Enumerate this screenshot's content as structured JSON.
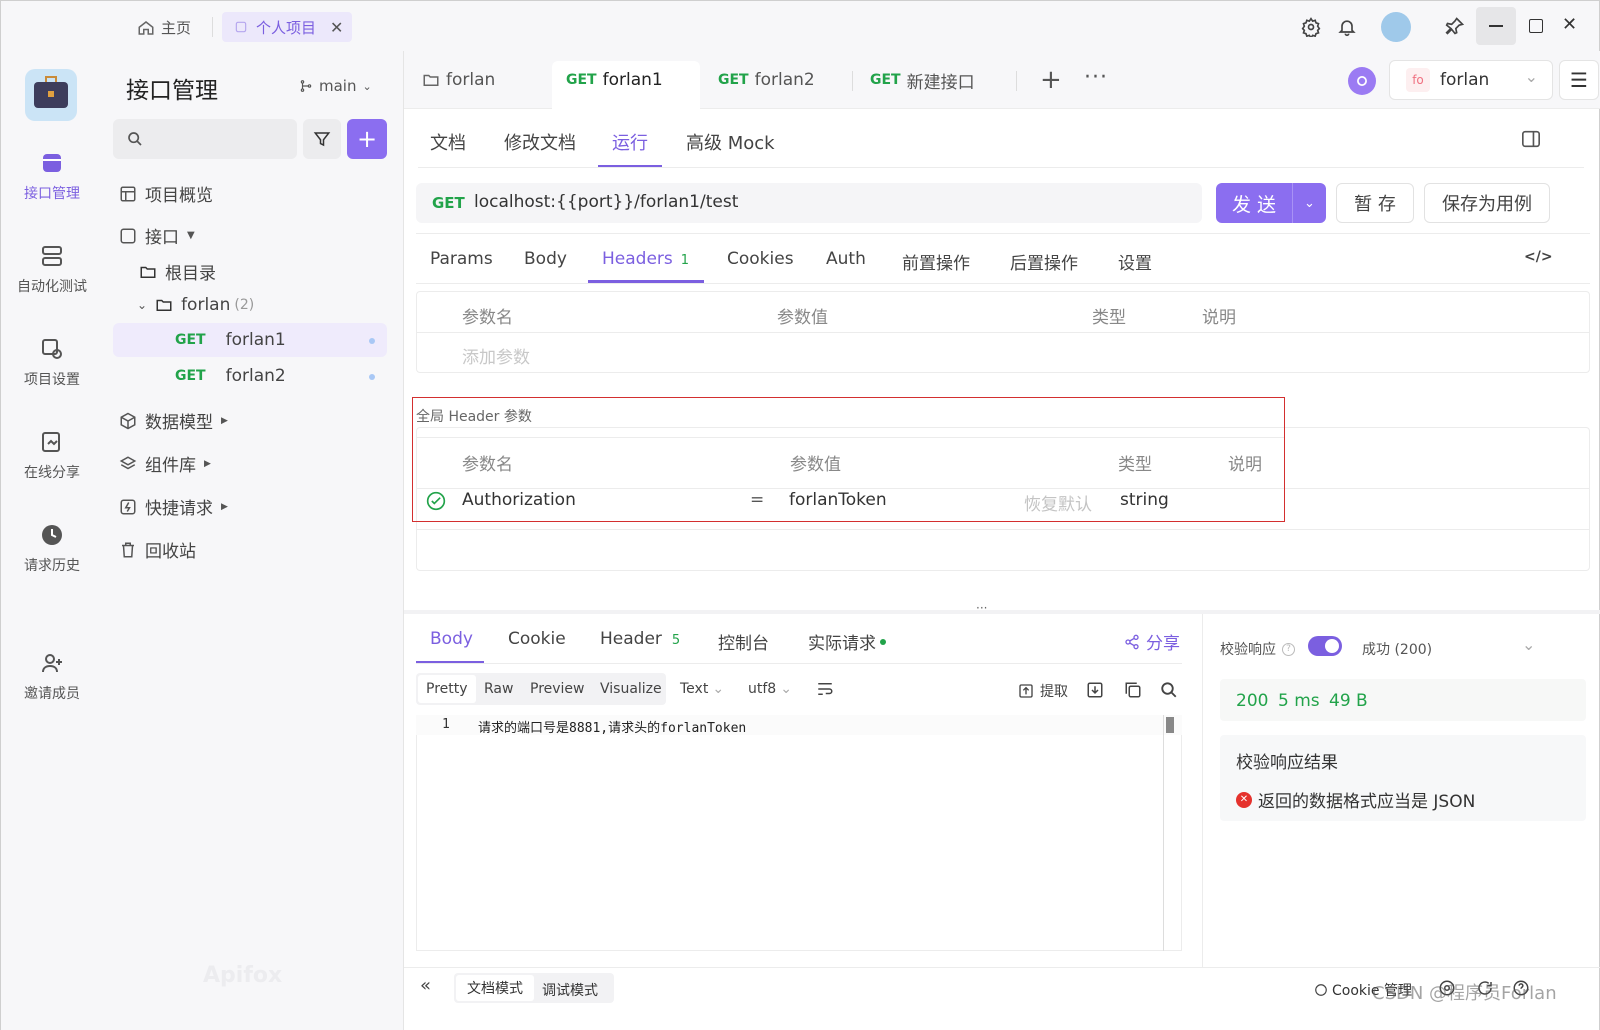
{
  "titlebar": {
    "home_label": "主页",
    "project_tab_label": "个人项目"
  },
  "rail": {
    "items": [
      {
        "label": "接口管理"
      },
      {
        "label": "自动化测试"
      },
      {
        "label": "项目设置"
      },
      {
        "label": "在线分享"
      },
      {
        "label": "请求历史"
      },
      {
        "label": "邀请成员"
      }
    ]
  },
  "sidebar": {
    "title": "接口管理",
    "branch": "main",
    "nav": [
      {
        "label": "项目概览"
      },
      {
        "label": "接口"
      },
      {
        "label": "根目录"
      },
      {
        "label": "forlan",
        "count": "(2)"
      },
      {
        "method": "GET",
        "label": "forlan1"
      },
      {
        "method": "GET",
        "label": "forlan2"
      },
      {
        "label": "数据模型"
      },
      {
        "label": "组件库"
      },
      {
        "label": "快捷请求"
      },
      {
        "label": "回收站"
      }
    ],
    "watermark": "Apifox"
  },
  "tabs": {
    "items": [
      {
        "method": "",
        "label": "forlan"
      },
      {
        "method": "GET",
        "label": "forlan1"
      },
      {
        "method": "GET",
        "label": "forlan2"
      },
      {
        "method": "GET",
        "label": "新建接口"
      }
    ],
    "env_avatar": "fo",
    "env_name": "forlan"
  },
  "subtabs": {
    "items": [
      "文档",
      "修改文档",
      "运行",
      "高级 Mock"
    ]
  },
  "request": {
    "method": "GET",
    "url": "localhost:{{port}}/forlan1/test",
    "send_label": "发 送",
    "save_label": "暂 存",
    "save_case_label": "保存为用例"
  },
  "param_tabs": {
    "items": [
      "Params",
      "Body",
      "Headers",
      "Cookies",
      "Auth",
      "前置操作",
      "后置操作",
      "设置"
    ],
    "headers_count": "1"
  },
  "headers_table": {
    "columns": [
      "参数名",
      "参数值",
      "类型",
      "说明"
    ],
    "add_placeholder": "添加参数"
  },
  "global_headers": {
    "title": "全局 Header 参数",
    "columns": [
      "参数名",
      "参数值",
      "类型",
      "说明"
    ],
    "row": {
      "name": "Authorization",
      "eq": "=",
      "value": "forlanToken",
      "restore": "恢复默认",
      "type": "string"
    }
  },
  "response": {
    "tabs": [
      "Body",
      "Cookie",
      "Header",
      "控制台",
      "实际请求"
    ],
    "header_count": "5",
    "share_label": "分享",
    "views": [
      "Pretty",
      "Raw",
      "Preview",
      "Visualize"
    ],
    "format": "Text",
    "encoding": "utf8",
    "extract_label": "提取",
    "line_number": "1",
    "body_text": "请求的端口号是8881,请求头的forlanToken"
  },
  "validation": {
    "label": "校验响应",
    "status": "成功 (200)",
    "code": "200",
    "time": "5 ms",
    "size": "49 B",
    "result_title": "校验响应结果",
    "error": "返回的数据格式应当是 JSON"
  },
  "footer": {
    "doc_mode": "文档模式",
    "debug_mode": "调试模式",
    "cookie_label": "Cookie 管理",
    "watermark": "CSDN @程序员Forlan"
  },
  "colors": {
    "accent": "#7b5fe0",
    "get": "#22a34a",
    "success": "#22a34a",
    "error": "#e5322d",
    "highlight_box": "#d32f2f"
  }
}
